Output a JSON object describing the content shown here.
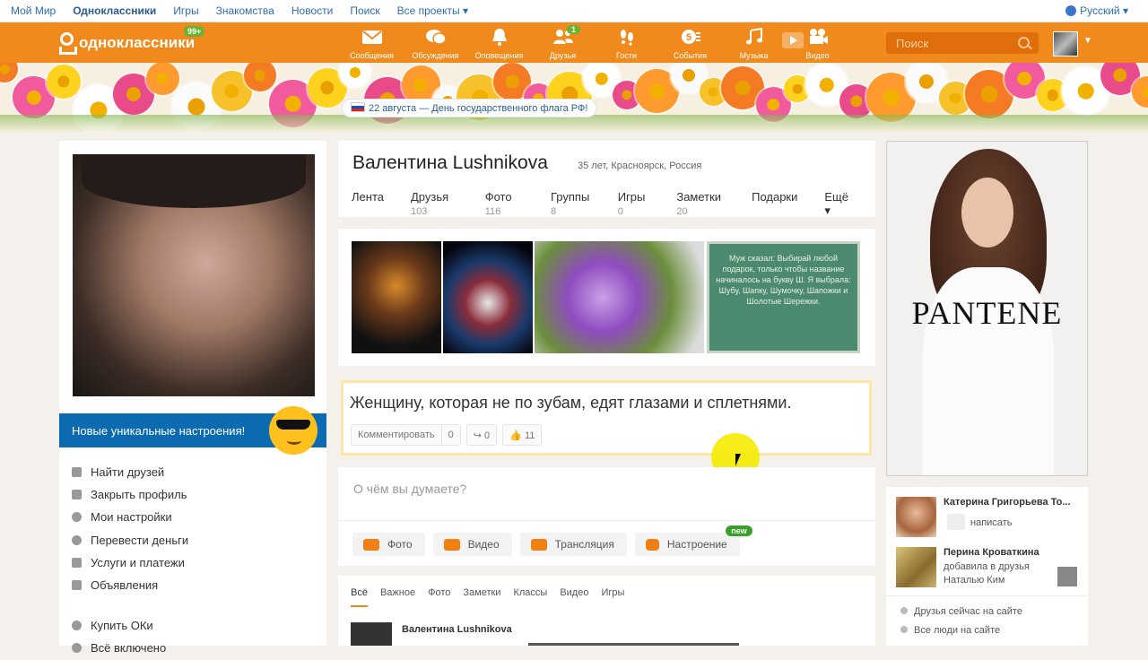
{
  "topbar": {
    "links": [
      "Мой Мир",
      "Одноклассники",
      "Игры",
      "Знакомства",
      "Новости",
      "Поиск",
      "Все проекты ▾"
    ],
    "language": "Русский ▾"
  },
  "header": {
    "logo": "одноклассники",
    "logo_badge": "99+",
    "nav": [
      {
        "label": "Сообщения",
        "icon": "envelope-icon",
        "count": ""
      },
      {
        "label": "Обсуждения",
        "icon": "chat-icon",
        "count": ""
      },
      {
        "label": "Оповещения",
        "icon": "bell-icon",
        "count": ""
      },
      {
        "label": "Друзья",
        "icon": "friends-icon",
        "count": "1"
      },
      {
        "label": "Гости",
        "icon": "footprints-icon",
        "count": ""
      },
      {
        "label": "События",
        "icon": "events-icon",
        "count": ""
      },
      {
        "label": "Музыка",
        "icon": "music-icon",
        "count": ""
      },
      {
        "label": "Видео",
        "icon": "video-camera-icon",
        "count": ""
      }
    ],
    "search_placeholder": "Поиск"
  },
  "banner": {
    "announcement": "22 августа — День государственного флага РФ!"
  },
  "left": {
    "mood_banner": "Новые уникальные настроения!",
    "menu": [
      "Найти друзей",
      "Закрыть профиль",
      "Мои настройки",
      "Перевести деньги",
      "Услуги и платежи",
      "Объявления"
    ],
    "menu2": [
      "Купить ОКи",
      "Всё включено"
    ]
  },
  "profile": {
    "name": "Валентина Lushnikova",
    "meta": "35 лет, Красноярск, Россия",
    "tabs": [
      {
        "label": "Лента",
        "count": ""
      },
      {
        "label": "Друзья",
        "count": "103"
      },
      {
        "label": "Фото",
        "count": "116"
      },
      {
        "label": "Группы",
        "count": "8"
      },
      {
        "label": "Игры",
        "count": "0"
      },
      {
        "label": "Заметки",
        "count": "20"
      },
      {
        "label": "Подарки",
        "count": ""
      },
      {
        "label": "Ещё ▾",
        "count": ""
      }
    ]
  },
  "photos": {
    "note_text": "Муж сказал: Выбирай любой подарок, только чтобы название начиналось на букву Ш. Я выбрала: Шубу, Шапку, Шумочку, Шапожки и Шолотые Шережки."
  },
  "status": {
    "text": "Женщину, которая не по зубам, едят глазами и сплетнями.",
    "comment_label": "Комментировать",
    "comment_count": "0",
    "share_count": "0",
    "like_count": "11"
  },
  "post": {
    "placeholder": "О чём вы думаете?",
    "buttons": [
      "Фото",
      "Видео",
      "Трансляция",
      "Настроение"
    ],
    "new_badge": "new"
  },
  "feed": {
    "tabs": [
      "Всё",
      "Важное",
      "Фото",
      "Заметки",
      "Классы",
      "Видео",
      "Игры"
    ],
    "first_author": "Валентина Lushnikova"
  },
  "ad": {
    "brand": "PANTENE"
  },
  "events": {
    "e1_name": "Катерина Григорьева То...",
    "e1_action": "написать",
    "e2_name": "Перина Кроваткина",
    "e2_line1": "добавила в друзья",
    "e2_line2": "Наталью Ким",
    "online_friends": "Друзья сейчас на сайте",
    "all_people": "Все люди на сайте"
  }
}
